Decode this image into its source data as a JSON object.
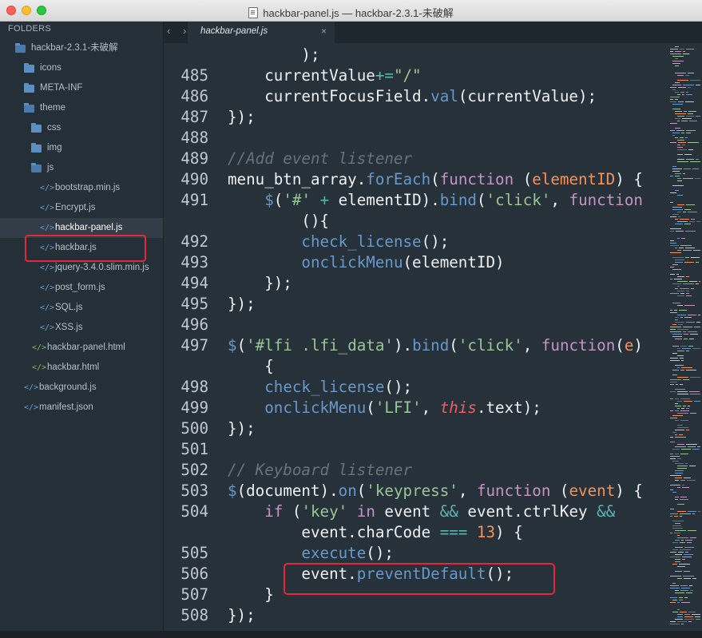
{
  "window": {
    "title": "hackbar-panel.js — hackbar-2.3.1-未破解"
  },
  "sidebar": {
    "header": "FOLDERS",
    "items": [
      {
        "label": "hackbar-2.3.1-未破解",
        "type": "folder-open",
        "level": 0
      },
      {
        "label": "icons",
        "type": "folder",
        "level": 1
      },
      {
        "label": "META-INF",
        "type": "folder",
        "level": 1
      },
      {
        "label": "theme",
        "type": "folder-open",
        "level": 1
      },
      {
        "label": "css",
        "type": "folder",
        "level": 2
      },
      {
        "label": "img",
        "type": "folder",
        "level": 2
      },
      {
        "label": "js",
        "type": "folder-open",
        "level": 2
      },
      {
        "label": "bootstrap.min.js",
        "type": "js",
        "level": 3
      },
      {
        "label": "Encrypt.js",
        "type": "js",
        "level": 3
      },
      {
        "label": "hackbar-panel.js",
        "type": "js",
        "level": 3,
        "active": true
      },
      {
        "label": "hackbar.js",
        "type": "js",
        "level": 3
      },
      {
        "label": "jquery-3.4.0.slim.min.js",
        "type": "js",
        "level": 3
      },
      {
        "label": "post_form.js",
        "type": "js",
        "level": 3
      },
      {
        "label": "SQL.js",
        "type": "js",
        "level": 3
      },
      {
        "label": "XSS.js",
        "type": "js",
        "level": 3
      },
      {
        "label": "hackbar-panel.html",
        "type": "html",
        "level": 2
      },
      {
        "label": "hackbar.html",
        "type": "html",
        "level": 2
      },
      {
        "label": "background.js",
        "type": "js",
        "level": 1
      },
      {
        "label": "manifest.json",
        "type": "js",
        "level": 1
      }
    ]
  },
  "tabbar": {
    "nav": "‹ ›",
    "active_tab": "hackbar-panel.js",
    "close": "×"
  },
  "editor": {
    "lines": [
      {
        "n": "",
        "tokens": [
          [
            "plain",
            "        );"
          ]
        ]
      },
      {
        "n": "485",
        "tokens": [
          [
            "plain",
            "    currentValue"
          ],
          [
            "op",
            "+="
          ],
          [
            "str",
            "\"/\""
          ]
        ]
      },
      {
        "n": "486",
        "tokens": [
          [
            "plain",
            "    currentFocusField."
          ],
          [
            "fn",
            "val"
          ],
          [
            "plain",
            "(currentValue);"
          ]
        ]
      },
      {
        "n": "487",
        "tokens": [
          [
            "plain",
            "});"
          ]
        ]
      },
      {
        "n": "488",
        "tokens": []
      },
      {
        "n": "489",
        "tokens": [
          [
            "cm",
            "//Add event listener"
          ]
        ]
      },
      {
        "n": "490",
        "tokens": [
          [
            "plain",
            "menu_btn_array."
          ],
          [
            "fn",
            "forEach"
          ],
          [
            "plain",
            "("
          ],
          [
            "kw",
            "function"
          ],
          [
            "plain",
            " ("
          ],
          [
            "param",
            "elementID"
          ],
          [
            "plain",
            ") {"
          ]
        ]
      },
      {
        "n": "491",
        "tokens": [
          [
            "plain",
            "    "
          ],
          [
            "fn",
            "$"
          ],
          [
            "plain",
            "("
          ],
          [
            "str",
            "'#'"
          ],
          [
            "plain",
            " "
          ],
          [
            "op",
            "+"
          ],
          [
            "plain",
            " elementID)."
          ],
          [
            "fn",
            "bind"
          ],
          [
            "plain",
            "("
          ],
          [
            "str",
            "'click'"
          ],
          [
            "plain",
            ", "
          ],
          [
            "kw",
            "function"
          ]
        ]
      },
      {
        "n": "",
        "tokens": [
          [
            "plain",
            "        (){"
          ]
        ]
      },
      {
        "n": "492",
        "tokens": [
          [
            "plain",
            "        "
          ],
          [
            "fn",
            "check_license"
          ],
          [
            "plain",
            "();"
          ]
        ]
      },
      {
        "n": "493",
        "tokens": [
          [
            "plain",
            "        "
          ],
          [
            "fn",
            "onclickMenu"
          ],
          [
            "plain",
            "(elementID)"
          ]
        ]
      },
      {
        "n": "494",
        "tokens": [
          [
            "plain",
            "    });"
          ]
        ]
      },
      {
        "n": "495",
        "tokens": [
          [
            "plain",
            "});"
          ]
        ]
      },
      {
        "n": "496",
        "tokens": []
      },
      {
        "n": "497",
        "tokens": [
          [
            "fn",
            "$"
          ],
          [
            "plain",
            "("
          ],
          [
            "str",
            "'#lfi .lfi_data'"
          ],
          [
            "plain",
            ")."
          ],
          [
            "fn",
            "bind"
          ],
          [
            "plain",
            "("
          ],
          [
            "str",
            "'click'"
          ],
          [
            "plain",
            ", "
          ],
          [
            "kw",
            "function"
          ],
          [
            "plain",
            "("
          ],
          [
            "param",
            "e"
          ],
          [
            "plain",
            ")"
          ]
        ]
      },
      {
        "n": "",
        "tokens": [
          [
            "plain",
            "    {"
          ]
        ]
      },
      {
        "n": "498",
        "tokens": [
          [
            "plain",
            "    "
          ],
          [
            "fn",
            "check_license"
          ],
          [
            "plain",
            "();"
          ]
        ]
      },
      {
        "n": "499",
        "tokens": [
          [
            "plain",
            "    "
          ],
          [
            "fn",
            "onclickMenu"
          ],
          [
            "plain",
            "("
          ],
          [
            "str",
            "'LFI'"
          ],
          [
            "plain",
            ", "
          ],
          [
            "this",
            "this"
          ],
          [
            "plain",
            ".text);"
          ]
        ]
      },
      {
        "n": "500",
        "tokens": [
          [
            "plain",
            "});"
          ]
        ]
      },
      {
        "n": "501",
        "tokens": []
      },
      {
        "n": "502",
        "tokens": [
          [
            "cm",
            "// Keyboard listener"
          ]
        ]
      },
      {
        "n": "503",
        "tokens": [
          [
            "fn",
            "$"
          ],
          [
            "plain",
            "(document)."
          ],
          [
            "fn",
            "on"
          ],
          [
            "plain",
            "("
          ],
          [
            "str",
            "'keypress'"
          ],
          [
            "plain",
            ", "
          ],
          [
            "kw",
            "function"
          ],
          [
            "plain",
            " ("
          ],
          [
            "param",
            "event"
          ],
          [
            "plain",
            ") {"
          ]
        ]
      },
      {
        "n": "504",
        "tokens": [
          [
            "plain",
            "    "
          ],
          [
            "kw",
            "if"
          ],
          [
            "plain",
            " ("
          ],
          [
            "str",
            "'key'"
          ],
          [
            "plain",
            " "
          ],
          [
            "kw",
            "in"
          ],
          [
            "plain",
            " event "
          ],
          [
            "op",
            "&&"
          ],
          [
            "plain",
            " event.ctrlKey "
          ],
          [
            "op",
            "&&"
          ]
        ]
      },
      {
        "n": "",
        "tokens": [
          [
            "plain",
            "        event.charCode "
          ],
          [
            "op",
            "==="
          ],
          [
            "plain",
            " "
          ],
          [
            "num",
            "13"
          ],
          [
            "plain",
            ") {"
          ]
        ]
      },
      {
        "n": "505",
        "tokens": [
          [
            "plain",
            "        "
          ],
          [
            "fn",
            "execute"
          ],
          [
            "plain",
            "();"
          ]
        ]
      },
      {
        "n": "506",
        "tokens": [
          [
            "plain",
            "        event."
          ],
          [
            "fn",
            "preventDefault"
          ],
          [
            "plain",
            "();"
          ]
        ]
      },
      {
        "n": "507",
        "tokens": [
          [
            "plain",
            "    }"
          ]
        ]
      },
      {
        "n": "508",
        "tokens": [
          [
            "plain",
            "});"
          ]
        ]
      }
    ]
  },
  "colors": {
    "annotation": "#e3283b",
    "background": "#27313a",
    "sidebar": "#252f38"
  }
}
